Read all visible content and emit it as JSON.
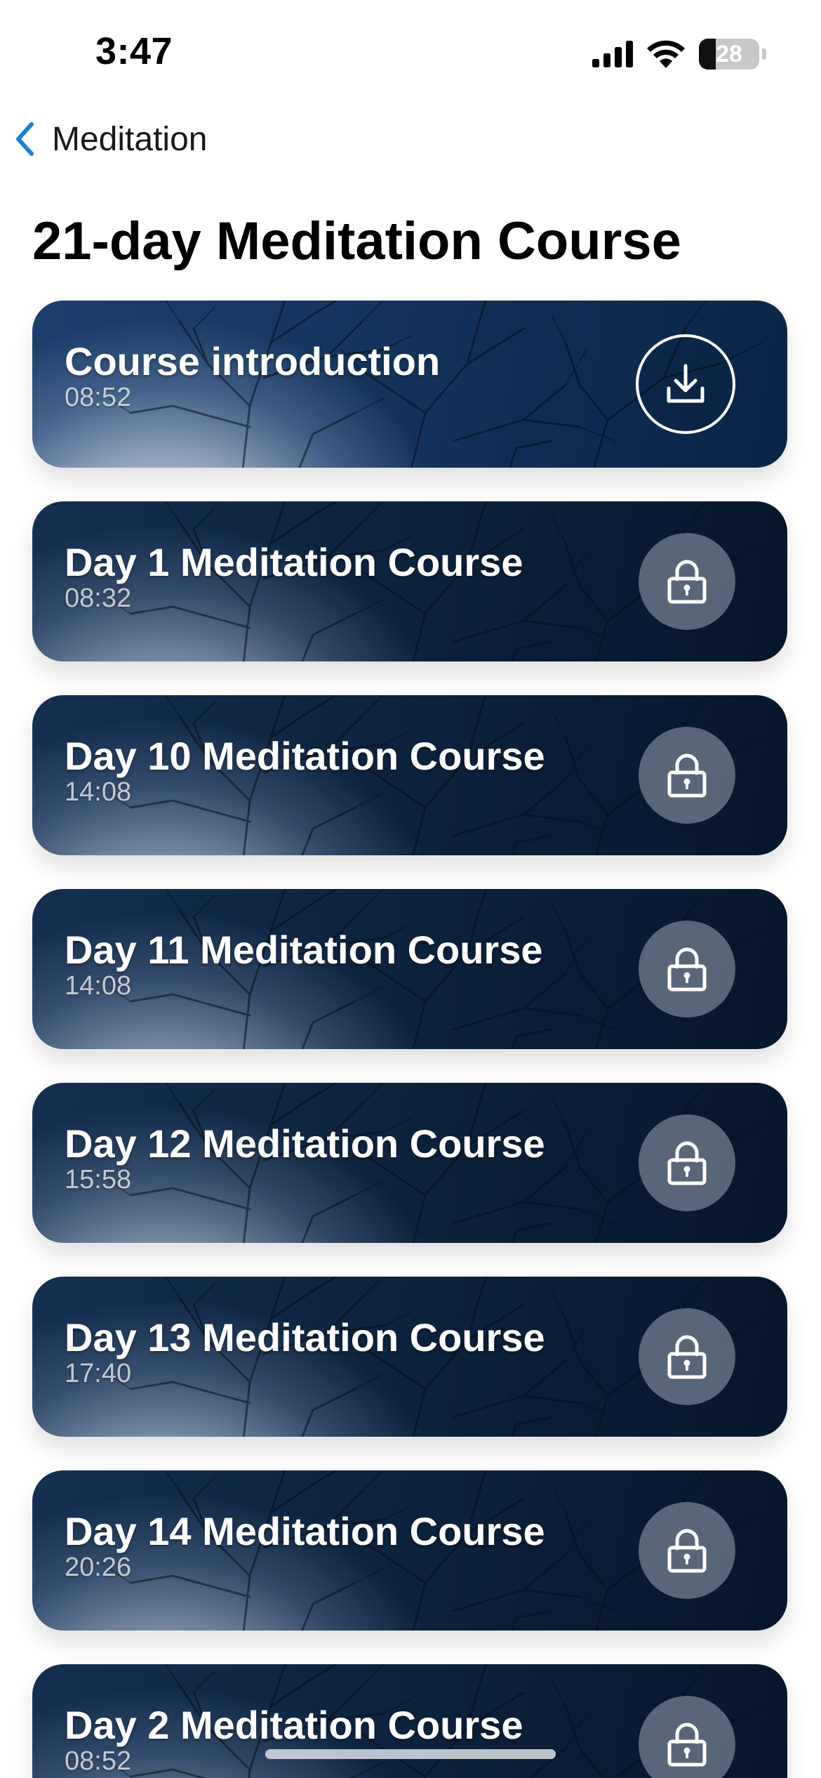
{
  "status_bar": {
    "time": "3:47",
    "battery_level": "28",
    "battery_fraction": 0.28,
    "icons": [
      "cellular-signal-icon",
      "wifi-icon",
      "battery-icon"
    ]
  },
  "nav": {
    "back_label": "Meditation",
    "back_icon": "chevron-left-icon",
    "accent_color": "#1a7fd9"
  },
  "page": {
    "title": "21-day Meditation Course"
  },
  "courses": [
    {
      "title": "Course introduction",
      "duration": "08:52",
      "action": "download",
      "action_icon": "download-icon"
    },
    {
      "title": "Day 1 Meditation Course",
      "duration": "08:32",
      "action": "locked",
      "action_icon": "lock-icon"
    },
    {
      "title": "Day 10 Meditation Course",
      "duration": "14:08",
      "action": "locked",
      "action_icon": "lock-icon"
    },
    {
      "title": "Day 11 Meditation Course",
      "duration": "14:08",
      "action": "locked",
      "action_icon": "lock-icon"
    },
    {
      "title": "Day 12 Meditation Course",
      "duration": "15:58",
      "action": "locked",
      "action_icon": "lock-icon"
    },
    {
      "title": "Day 13 Meditation Course",
      "duration": "17:40",
      "action": "locked",
      "action_icon": "lock-icon"
    },
    {
      "title": "Day 14 Meditation Course",
      "duration": "20:26",
      "action": "locked",
      "action_icon": "lock-icon"
    },
    {
      "title": "Day 2 Meditation Course",
      "duration": "08:52",
      "action": "locked",
      "action_icon": "lock-icon"
    }
  ]
}
